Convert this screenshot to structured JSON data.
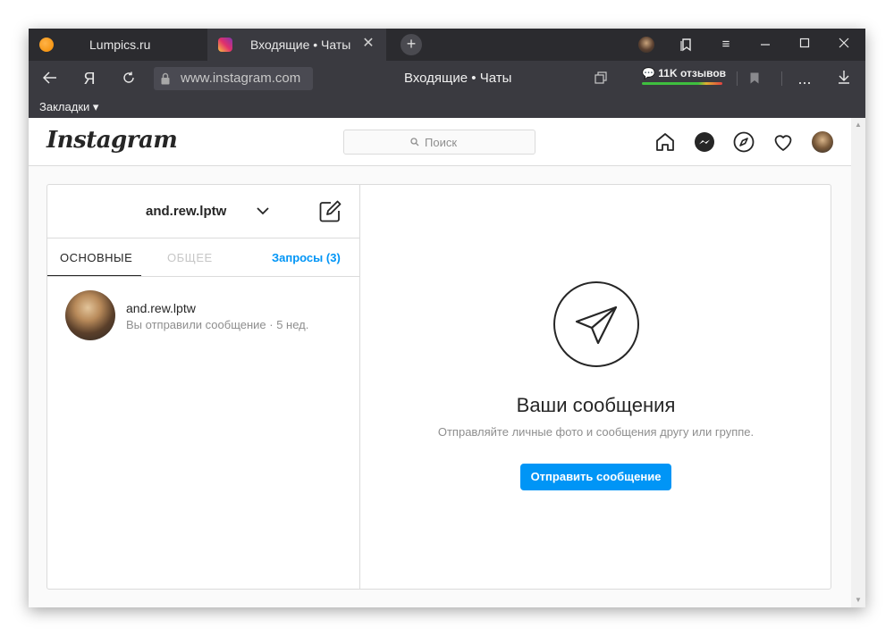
{
  "browser": {
    "tabs": [
      {
        "title": "Lumpics.ru",
        "active": false
      },
      {
        "title": "Входящие • Чаты",
        "active": true
      }
    ],
    "new_tab_symbol": "+",
    "close_symbol": "✕",
    "window_controls": {
      "menu": "≡",
      "minimize": "—",
      "maximize": "☐",
      "close": "✕"
    },
    "address": {
      "url": "www.instagram.com",
      "yandex_label": "Я",
      "page_title": "Входящие • Чаты",
      "reviews": "11K отзывов",
      "more": "..."
    },
    "bookmarks_label": "Закладки ▾"
  },
  "instagram": {
    "logo": "Instagram",
    "search_placeholder": "Поиск",
    "icons": [
      "home-icon",
      "messenger-icon",
      "explore-icon",
      "heart-icon",
      "profile-avatar"
    ]
  },
  "direct": {
    "username": "and.rew.lptw",
    "tabs": {
      "main": "ОСНОВНЫЕ",
      "general": "ОБЩЕЕ",
      "requests": "Запросы (3)"
    },
    "threads": [
      {
        "name": "and.rew.lptw",
        "preview": "Вы отправили сообщение · 5 нед."
      }
    ],
    "empty": {
      "title": "Ваши сообщения",
      "subtitle": "Отправляйте личные фото и сообщения другу или группе.",
      "button": "Отправить сообщение"
    }
  },
  "colors": {
    "accent": "#0095f6",
    "browser_dark": "#2b2b2f",
    "browser_toolbar": "#3a3a40"
  }
}
